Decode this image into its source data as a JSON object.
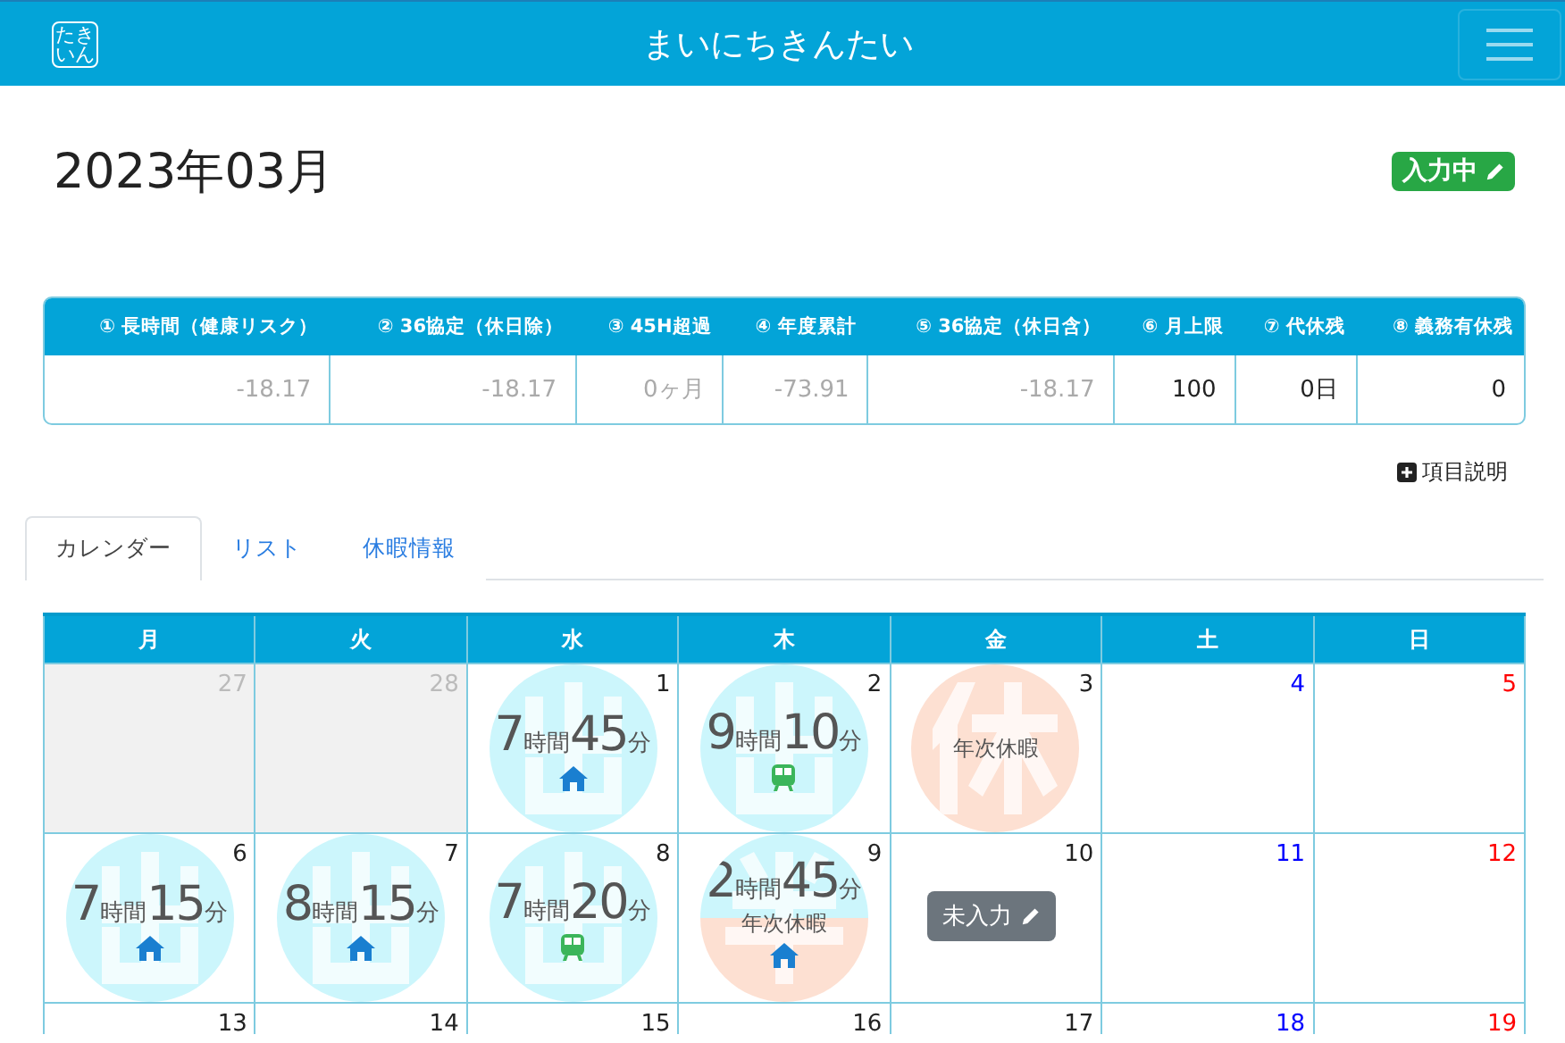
{
  "navbar": {
    "logo": "たきいん",
    "title": "まいにちきんたい"
  },
  "header": {
    "month": "2023年03月",
    "status": "入力中"
  },
  "summary": {
    "columns": [
      "① 長時間（健康リスク）",
      "② 36協定（休日除）",
      "③ 45H超過",
      "④ 年度累計",
      "⑤ 36協定（休日含）",
      "⑥ 月上限",
      "⑦ 代休残",
      "⑧ 義務有休残"
    ],
    "values": [
      {
        "text": "-18.17",
        "muted": true
      },
      {
        "text": "-18.17",
        "muted": true
      },
      {
        "text": "0ヶ月",
        "muted": true
      },
      {
        "text": "-73.91",
        "muted": true
      },
      {
        "text": "-18.17",
        "muted": true
      },
      {
        "text": "100",
        "muted": false
      },
      {
        "text": "0日",
        "muted": false
      },
      {
        "text": "0",
        "muted": false
      }
    ]
  },
  "help_link": "項目説明",
  "tabs": [
    {
      "label": "カレンダー",
      "selected": true
    },
    {
      "label": "リスト",
      "selected": false
    },
    {
      "label": "休暇情報",
      "selected": false
    }
  ],
  "calendar": {
    "weekdays": [
      "月",
      "火",
      "水",
      "木",
      "金",
      "土",
      "日"
    ],
    "weeks": [
      [
        {
          "date": "27",
          "kind": "other",
          "color": "#bbbbbb"
        },
        {
          "date": "28",
          "kind": "other",
          "color": "#bbbbbb"
        },
        {
          "date": "1",
          "kind": "work",
          "color": "#222222",
          "hours": "7",
          "hours_unit": "時間",
          "minutes": "45",
          "minutes_unit": "分",
          "commute": {
            "kind": "home"
          }
        },
        {
          "date": "2",
          "kind": "work",
          "color": "#222222",
          "hours": "9",
          "hours_unit": "時間",
          "minutes": "10",
          "minutes_unit": "分",
          "commute": {
            "kind": "train"
          }
        },
        {
          "date": "3",
          "kind": "leave",
          "color": "#222222",
          "leave": "年次休暇"
        },
        {
          "date": "4",
          "kind": "empty",
          "color": "#0000ff"
        },
        {
          "date": "5",
          "kind": "empty",
          "color": "#ff0000"
        }
      ],
      [
        {
          "date": "6",
          "kind": "work",
          "color": "#222222",
          "hours": "7",
          "hours_unit": "時間",
          "minutes": "15",
          "minutes_unit": "分",
          "commute": {
            "kind": "home"
          }
        },
        {
          "date": "7",
          "kind": "work",
          "color": "#222222",
          "hours": "8",
          "hours_unit": "時間",
          "minutes": "15",
          "minutes_unit": "分",
          "commute": {
            "kind": "home"
          }
        },
        {
          "date": "8",
          "kind": "work",
          "color": "#222222",
          "hours": "7",
          "hours_unit": "時間",
          "minutes": "20",
          "minutes_unit": "分",
          "commute": {
            "kind": "train"
          }
        },
        {
          "date": "9",
          "kind": "mixed",
          "color": "#222222",
          "hours": "2",
          "hours_unit": "時間",
          "minutes": "45",
          "minutes_unit": "分",
          "leave": "年次休暇",
          "commute": {
            "kind": "home"
          }
        },
        {
          "date": "10",
          "kind": "unentered",
          "color": "#222222",
          "button": "未入力"
        },
        {
          "date": "11",
          "kind": "empty",
          "color": "#0000ff"
        },
        {
          "date": "12",
          "kind": "empty",
          "color": "#ff0000"
        }
      ],
      [
        {
          "date": "13",
          "kind": "empty",
          "color": "#222222"
        },
        {
          "date": "14",
          "kind": "empty",
          "color": "#222222"
        },
        {
          "date": "15",
          "kind": "empty",
          "color": "#222222"
        },
        {
          "date": "16",
          "kind": "empty",
          "color": "#222222"
        },
        {
          "date": "17",
          "kind": "empty",
          "color": "#222222"
        },
        {
          "date": "18",
          "kind": "empty",
          "color": "#0000ff"
        },
        {
          "date": "19",
          "kind": "empty",
          "color": "#ff0000"
        }
      ]
    ]
  }
}
